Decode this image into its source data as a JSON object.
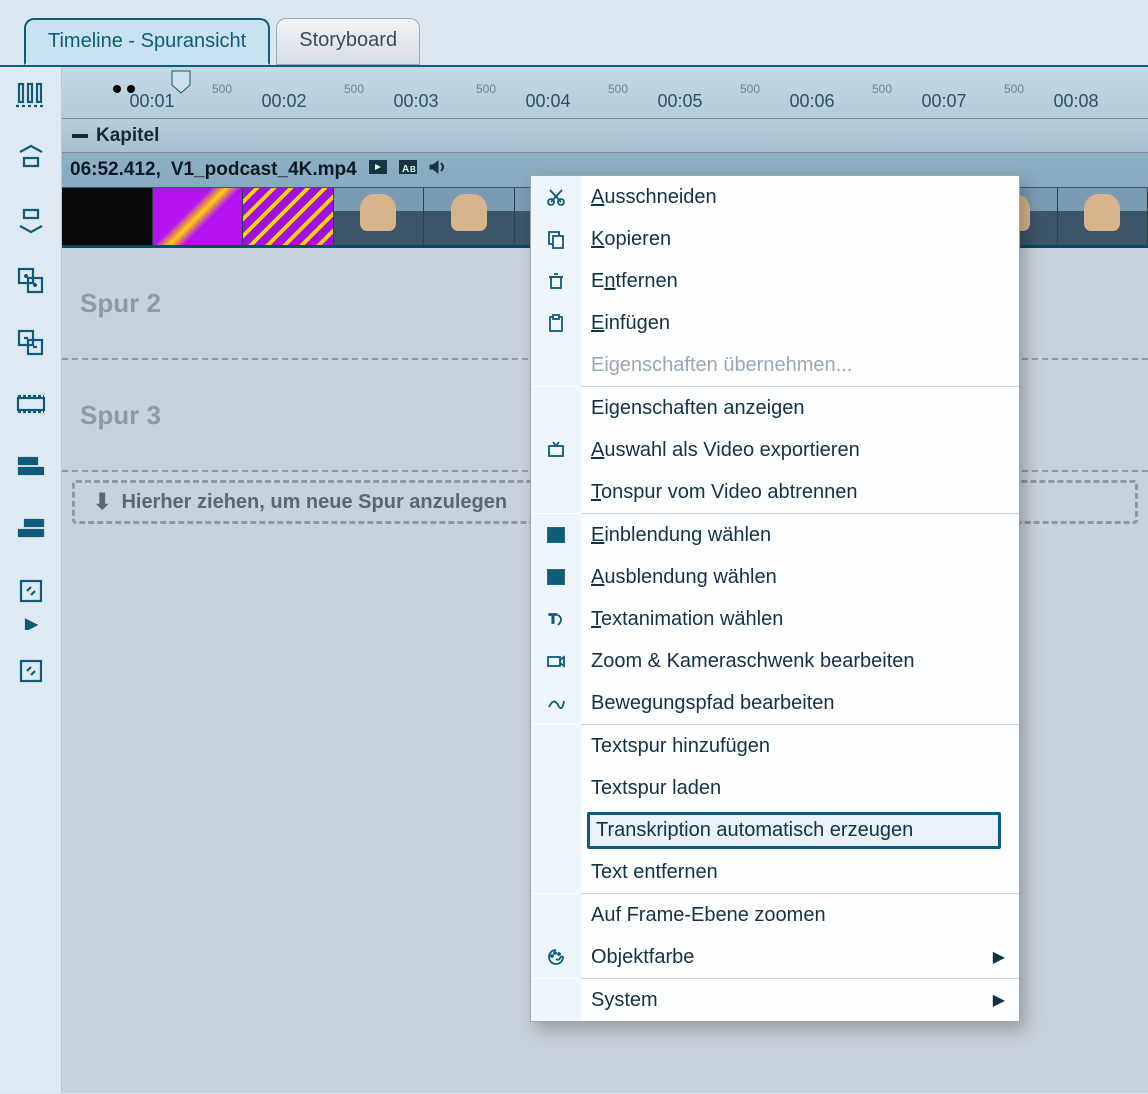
{
  "tabs": {
    "timeline": "Timeline - Spuransicht",
    "storyboard": "Storyboard"
  },
  "ruler": {
    "big": [
      "00:01",
      "00:02",
      "00:03",
      "00:04",
      "00:05",
      "00:06",
      "00:07",
      "00:08"
    ],
    "small": "500"
  },
  "kapitel_label": "Kapitel",
  "clip": {
    "time": "06:52.412,",
    "filename": "V1_podcast_4K.mp4"
  },
  "tracks": {
    "spur2": "Spur 2",
    "spur3": "Spur 3",
    "dropzone": "Hierher ziehen, um neue Spur anzulegen"
  },
  "menu": {
    "ausschneiden": "Ausschneiden",
    "kopieren": "Kopieren",
    "entfernen": "Entfernen",
    "einfuegen": "Einfügen",
    "eig_uebernehmen": "Eigenschaften übernehmen...",
    "eig_anzeigen": "Eigenschaften anzeigen",
    "auswahl_export": "Auswahl als Video exportieren",
    "tonspur": "Tonspur vom Video abtrennen",
    "einblendung": "Einblendung wählen",
    "ausblendung": "Ausblendung wählen",
    "textanimation": "Textanimation wählen",
    "zoom_kamera": "Zoom & Kameraschwenk bearbeiten",
    "bewegungspfad": "Bewegungspfad bearbeiten",
    "textspur_hinzu": "Textspur hinzufügen",
    "textspur_laden": "Textspur laden",
    "transkription": "Transkription automatisch erzeugen",
    "text_entfernen": "Text entfernen",
    "frame_zoom": "Auf Frame-Ebene zoomen",
    "objektfarbe": "Objektfarbe",
    "system": "System"
  }
}
